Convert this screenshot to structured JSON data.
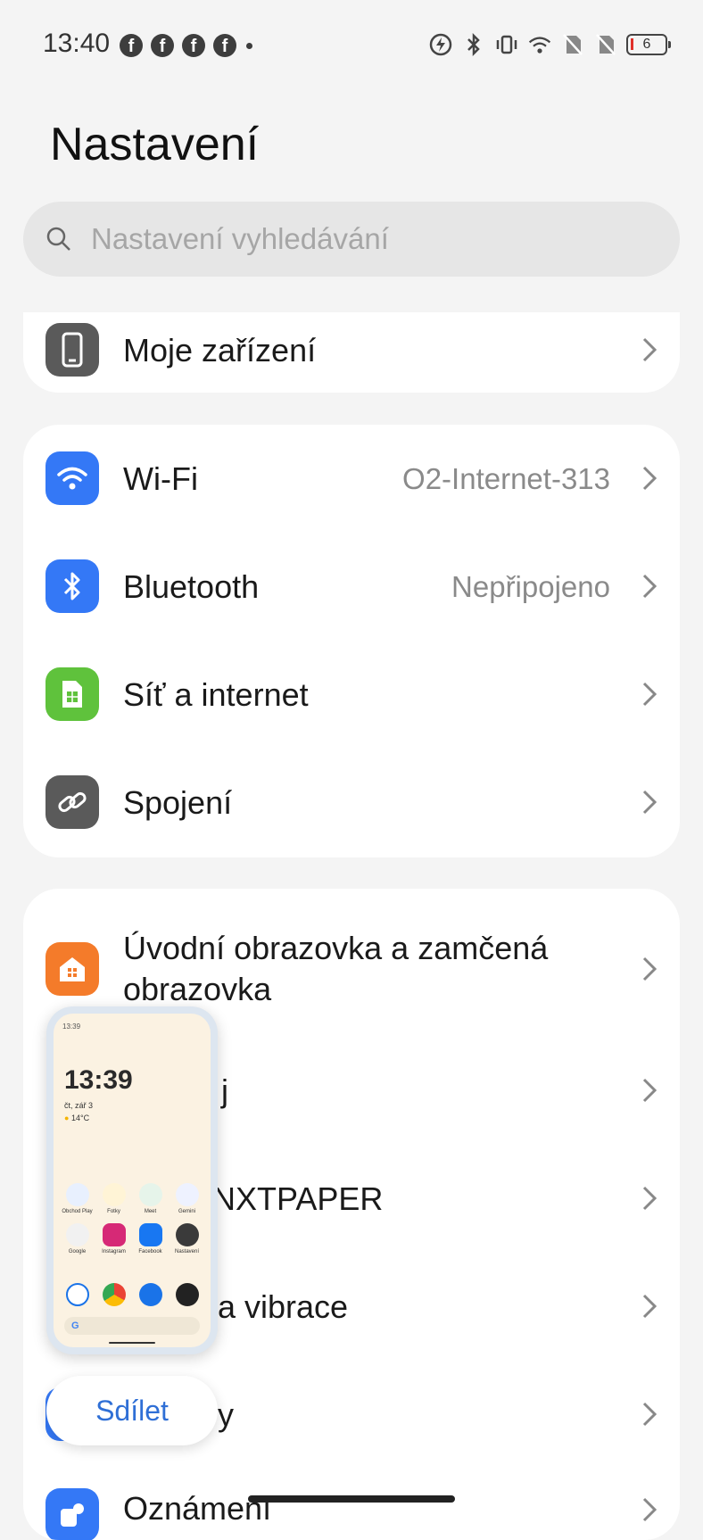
{
  "status_bar": {
    "time": "13:40",
    "notification_icons": [
      "facebook-icon",
      "facebook-icon",
      "facebook-icon",
      "facebook-icon"
    ],
    "battery_level": "6"
  },
  "page": {
    "title": "Nastavení"
  },
  "search": {
    "placeholder": "Nastavení vyhledávání"
  },
  "rows": {
    "device": {
      "label": "Moje zařízení",
      "icon": "phone-icon",
      "icon_color": "#5a5a5a"
    },
    "wifi": {
      "label": "Wi-Fi",
      "value": "O2-Internet-313",
      "icon": "wifi-icon",
      "icon_color": "#3478f6"
    },
    "bluetooth": {
      "label": "Bluetooth",
      "value": "Nepřipojeno",
      "icon": "bluetooth-icon",
      "icon_color": "#3478f6"
    },
    "network": {
      "label": "Síť a internet",
      "icon": "sim-card-icon",
      "icon_color": "#5fc23c"
    },
    "connection": {
      "label": "Spojení",
      "icon": "link-icon",
      "icon_color": "#5a5a5a"
    },
    "homescreen": {
      "label": "Úvodní obrazovka a zamčená obrazovka",
      "icon": "home-icon",
      "icon_color": "#f47b2a"
    },
    "row_j": {
      "label": "j"
    },
    "nxtpaper": {
      "label": "NXTPAPER"
    },
    "sound": {
      "label": "a vibrace"
    },
    "row_y": {
      "label": "y"
    },
    "notifications": {
      "label": "Oznámení"
    }
  },
  "thumbnail": {
    "status": "13:39",
    "time": "13:39",
    "date": "čt, zář 3",
    "temp": "14°C",
    "apps": [
      {
        "label": "Obchod Play",
        "color": "#e8f0fe"
      },
      {
        "label": "Fotky",
        "color": "#fff4d6"
      },
      {
        "label": "Meet",
        "color": "#e6f4ea"
      },
      {
        "label": "Gemini",
        "color": "#eef2ff"
      },
      {
        "label": "Google",
        "color": "#f1f1f1"
      },
      {
        "label": "Instagram",
        "color": "#d62976"
      },
      {
        "label": "Facebook",
        "color": "#1877f2"
      },
      {
        "label": "Nastavení",
        "color": "#3a3a3a"
      }
    ],
    "dock": [
      "#1a73e8",
      "#ffffff",
      "#1a73e8",
      "#222222"
    ],
    "search_glyph": "G"
  },
  "share": {
    "label": "Sdílet"
  }
}
